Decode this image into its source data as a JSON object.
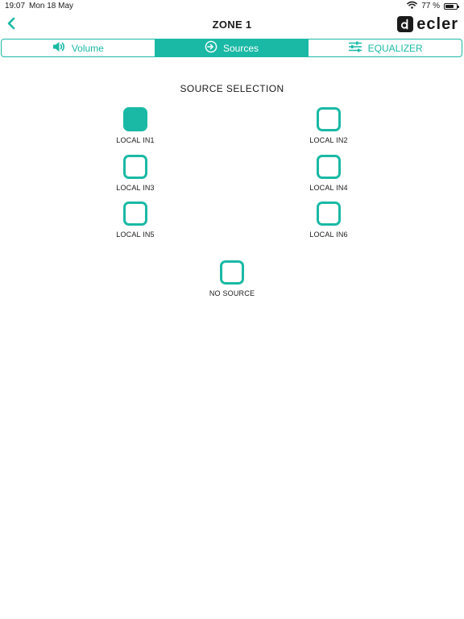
{
  "status_bar": {
    "time": "19:07",
    "date": "Mon 18 May",
    "battery_percent_text": "77 %",
    "battery_level": 0.77
  },
  "nav": {
    "title": "ZONE 1",
    "brand": "ecler"
  },
  "tabs": [
    {
      "label": "Volume",
      "icon": "speaker-icon",
      "active": false
    },
    {
      "label": "Sources",
      "icon": "source-input-icon",
      "active": true
    },
    {
      "label": "EQUALIZER",
      "icon": "sliders-icon",
      "active": false
    }
  ],
  "section": {
    "title": "SOURCE SELECTION"
  },
  "sources": [
    {
      "label": "LOCAL IN1",
      "selected": true
    },
    {
      "label": "LOCAL IN2",
      "selected": false
    },
    {
      "label": "LOCAL IN3",
      "selected": false
    },
    {
      "label": "LOCAL IN4",
      "selected": false
    },
    {
      "label": "LOCAL IN5",
      "selected": false
    },
    {
      "label": "LOCAL IN6",
      "selected": false
    },
    {
      "label": "NO SOURCE",
      "selected": false
    }
  ],
  "colors": {
    "accent": "#1ab9a5",
    "text": "#1a1a1a",
    "background": "#ffffff"
  }
}
